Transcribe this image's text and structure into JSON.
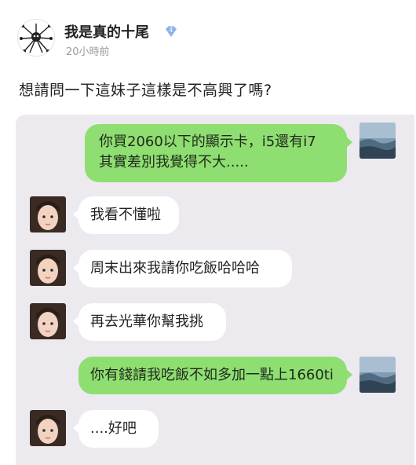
{
  "post": {
    "author": "我是真的十尾",
    "badge_level": "4",
    "time": "20小時前",
    "text": "想請問一下這妹子這樣是不高興了嗎?"
  },
  "messages": [
    {
      "side": "out",
      "line1": "你買2060以下的顯示卡，i5還有i7",
      "line2": "其實差別我覺得不大....."
    },
    {
      "side": "in",
      "text": "我看不懂啦"
    },
    {
      "side": "in",
      "text": "周末出來我請你吃飯哈哈哈"
    },
    {
      "side": "in",
      "text": "再去光華你幫我挑"
    },
    {
      "side": "out",
      "text": "你有錢請我吃飯不如多加一點上1660ti"
    },
    {
      "side": "in",
      "text": "....好吧"
    }
  ],
  "colors": {
    "out_bubble": "#8fde72",
    "in_bubble": "#ffffff",
    "chat_background": "#ece9ef",
    "badge": "#8fb2e6"
  }
}
